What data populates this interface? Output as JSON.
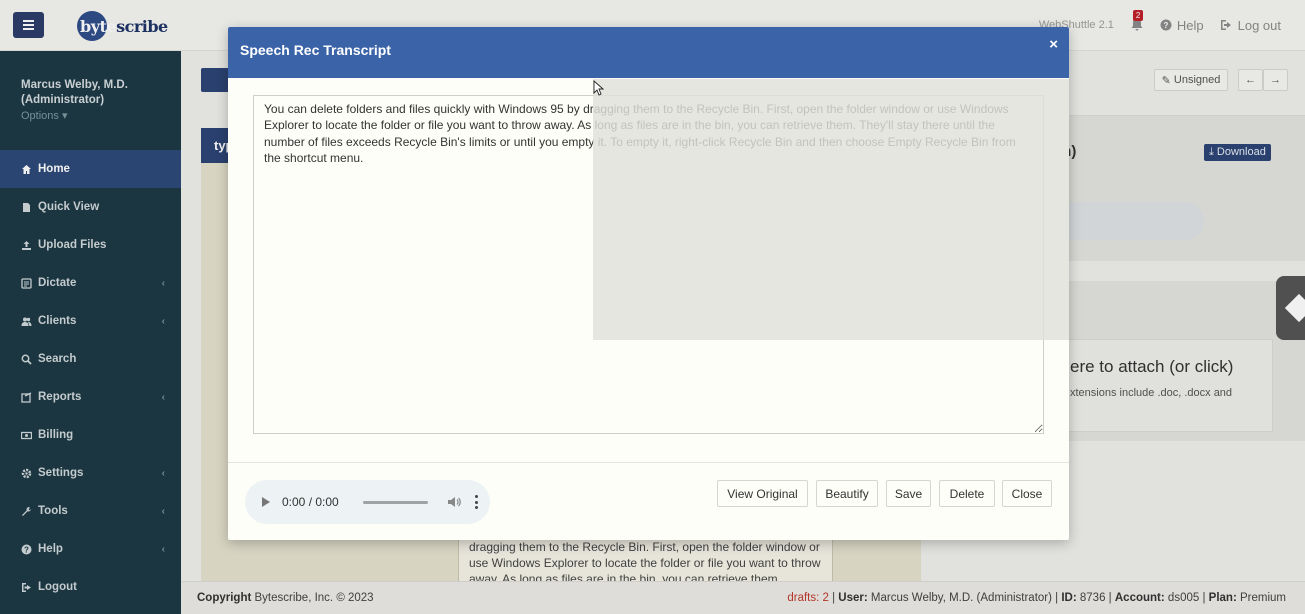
{
  "topbar": {
    "logo_first": "byte",
    "logo_rest": "scribe",
    "version": "WebShuttle 2.1",
    "notification_count": "2",
    "help_label": "Help",
    "logout_label": "Log out"
  },
  "sidebar": {
    "user_name": "Marcus Welby, M.D.",
    "user_role": "(Administrator)",
    "options_label": "Options",
    "items": [
      {
        "label": "Home",
        "icon": "home-icon",
        "active": true
      },
      {
        "label": "Quick View",
        "icon": "file-icon"
      },
      {
        "label": "Upload Files",
        "icon": "upload-icon"
      },
      {
        "label": "Dictate",
        "icon": "microphone-icon",
        "submenu": true
      },
      {
        "label": "Clients",
        "icon": "users-icon",
        "submenu": true
      },
      {
        "label": "Search",
        "icon": "search-icon"
      },
      {
        "label": "Reports",
        "icon": "reports-icon",
        "submenu": true
      },
      {
        "label": "Billing",
        "icon": "money-icon"
      },
      {
        "label": "Settings",
        "icon": "gear-icon",
        "submenu": true
      },
      {
        "label": "Tools",
        "icon": "wrench-icon",
        "submenu": true
      },
      {
        "label": "Help",
        "icon": "question-icon",
        "submenu": true
      },
      {
        "label": "Logout",
        "icon": "logout-icon"
      }
    ]
  },
  "main": {
    "unsigned_label": "Unsigned",
    "left_tab_label": "typ",
    "right_panel_title": "in)",
    "download_label": "Download",
    "drop_title": "ere to attach (or click)",
    "drop_sub": "xtensions include .doc, .docx and",
    "bg_text": "dragging them to the Recycle Bin. First, open the folder window or use Windows Explorer to locate the folder or file you want to throw away. As long as files are in the bin, you can retrieve them"
  },
  "modal": {
    "title": "Speech Rec Transcript",
    "close_glyph": "×",
    "transcript": "You can delete folders and files quickly with Windows 95 by dragging them to the Recycle Bin. First, open the folder window or use Windows Explorer to locate the folder or file you want to throw away. As long as files are in the bin, you can retrieve them. They'll stay there until the number of files exceeds Recycle Bin's limits or until you empty it. To empty it, right-click Recycle Bin and then choose Empty Recycle Bin from the shortcut menu.",
    "audio_time": "0:00 / 0:00",
    "buttons": {
      "view_original": "View Original",
      "beautify": "Beautify",
      "save": "Save",
      "delete": "Delete",
      "close": "Close"
    }
  },
  "footer": {
    "copyright_label": "Copyright",
    "copyright_text": "Bytescribe, Inc. © 2023",
    "drafts": "drafts: 2",
    "user_label": "User:",
    "user_value": "Marcus Welby, M.D. (Administrator)",
    "id_label": "ID:",
    "id_value": "8736",
    "account_label": "Account:",
    "account_value": "ds005",
    "plan_label": "Plan:",
    "plan_value": "Premium"
  },
  "colors": {
    "sidebar_bg": "#1d3a44",
    "active_nav": "#2e4a7a",
    "modal_header": "#3b64a8",
    "brand": "#2d4475",
    "alert": "#c0202a"
  }
}
